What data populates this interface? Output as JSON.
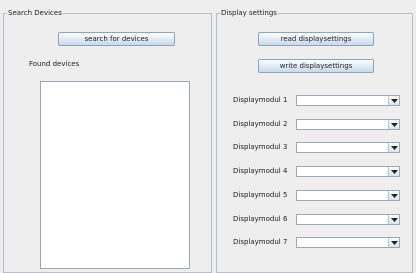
{
  "search": {
    "title": "Search Devices",
    "button_label": "search for devices",
    "found_label": "Found devices",
    "devices": []
  },
  "display": {
    "title": "Display settings",
    "read_button_label": "read displaysettings",
    "write_button_label": "write displaysettings",
    "modules": [
      {
        "label": "Displaymodul 1",
        "value": ""
      },
      {
        "label": "Displaymodul 2",
        "value": ""
      },
      {
        "label": "Displaymodul 3",
        "value": ""
      },
      {
        "label": "Displaymodul 4",
        "value": ""
      },
      {
        "label": "Displaymodul 5",
        "value": ""
      },
      {
        "label": "Displaymodul 6",
        "value": ""
      },
      {
        "label": "Displaymodul 7",
        "value": ""
      }
    ]
  }
}
